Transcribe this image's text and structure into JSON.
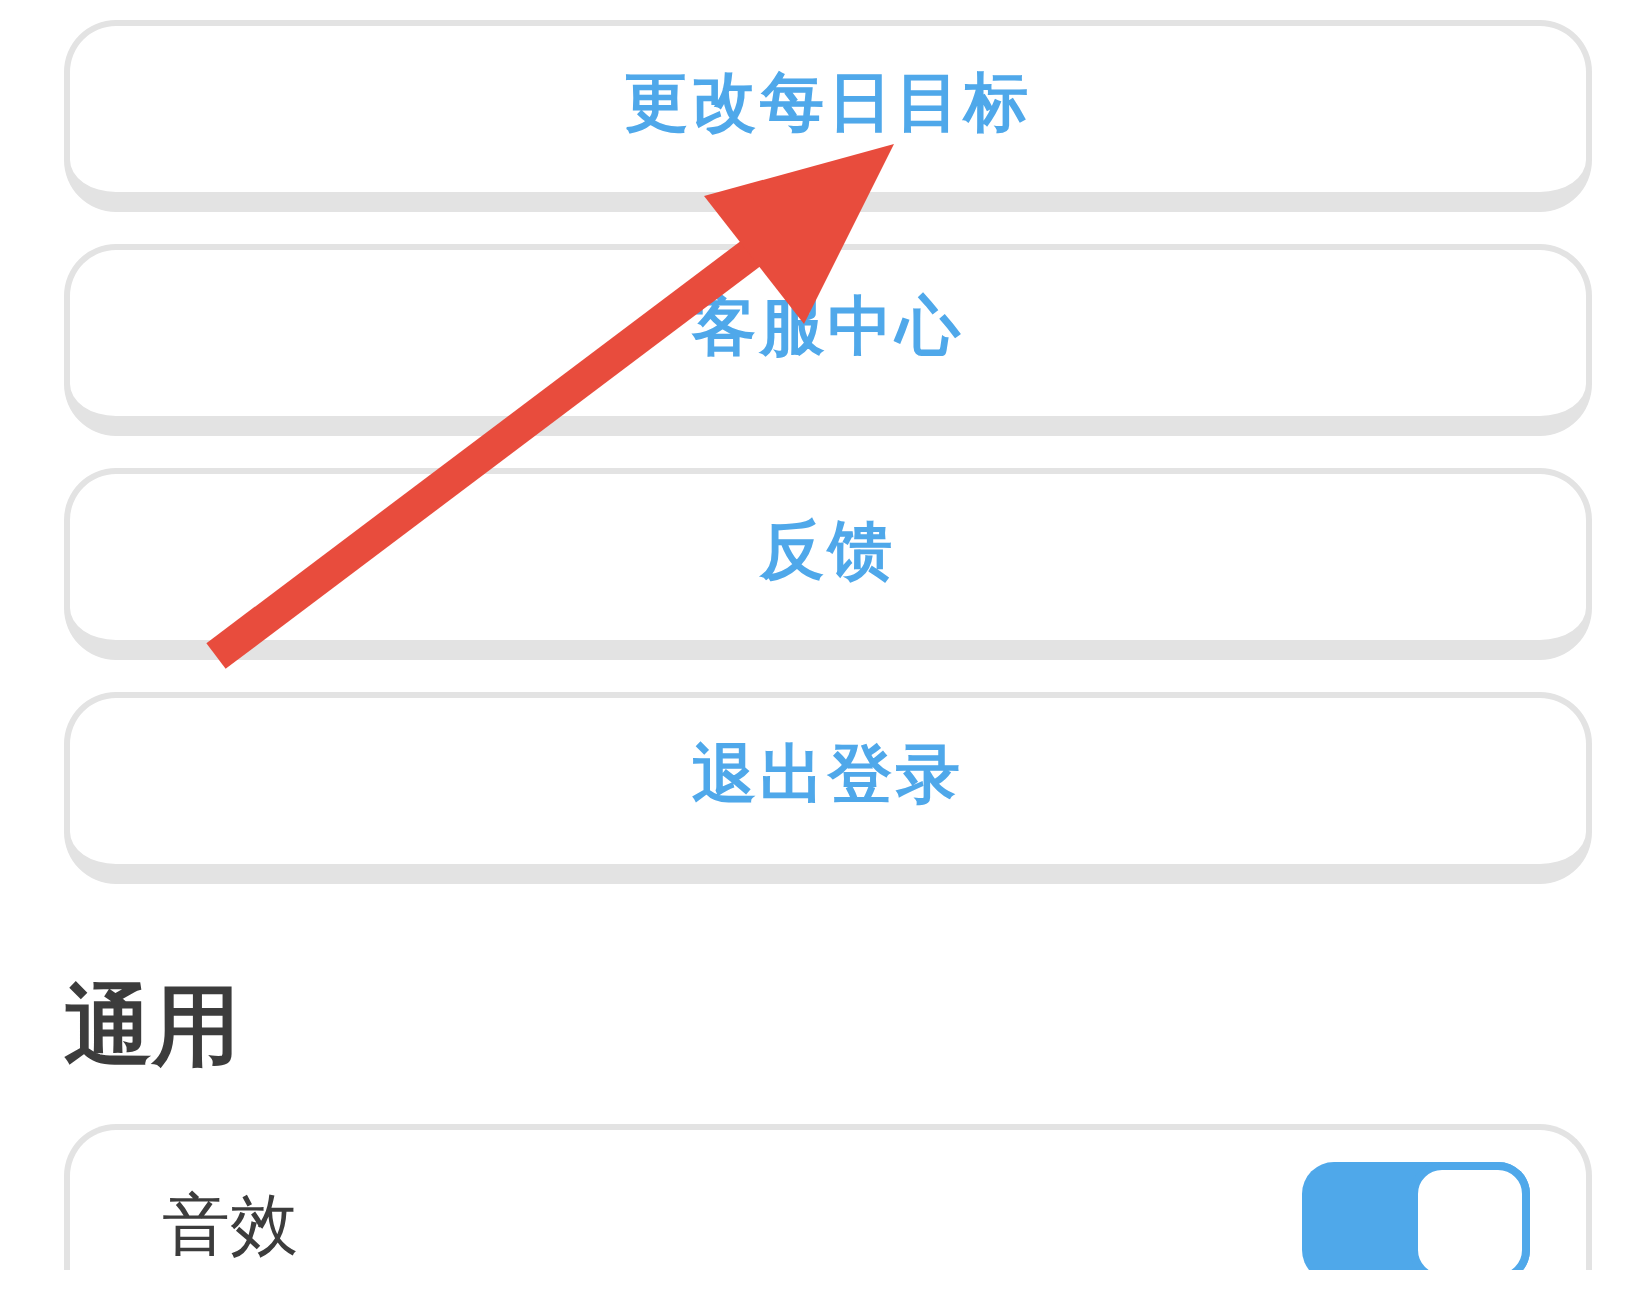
{
  "menu_buttons": [
    {
      "label": "更改每日目标"
    },
    {
      "label": "客服中心"
    },
    {
      "label": "反馈"
    },
    {
      "label": "退出登录"
    }
  ],
  "section": {
    "title": "通用",
    "rows": [
      {
        "label": "音效",
        "on": true
      }
    ]
  }
}
